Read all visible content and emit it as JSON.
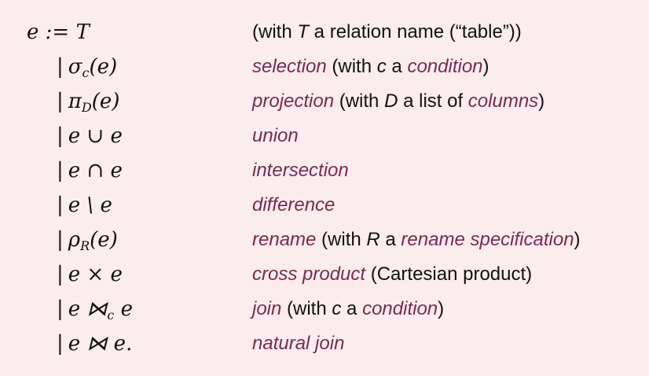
{
  "grammar": {
    "rows": [
      {
        "lhs": {
          "bar": "",
          "a": "e := T",
          "sub": "",
          "b": ""
        },
        "rhs": [
          {
            "text": "(with ",
            "style": "plain"
          },
          {
            "text": "T",
            "style": "var"
          },
          {
            "text": " a relation name (“table”))",
            "style": "plain"
          }
        ]
      },
      {
        "lhs": {
          "bar": "|",
          "a": "σ",
          "sub": "c",
          "b": "(e)"
        },
        "rhs": [
          {
            "text": "selection",
            "style": "hl"
          },
          {
            "text": " (with ",
            "style": "plain"
          },
          {
            "text": "c",
            "style": "var"
          },
          {
            "text": " a ",
            "style": "plain"
          },
          {
            "text": "condition",
            "style": "hl"
          },
          {
            "text": ")",
            "style": "plain"
          }
        ]
      },
      {
        "lhs": {
          "bar": "|",
          "a": "π",
          "sub": "D",
          "b": "(e)"
        },
        "rhs": [
          {
            "text": "projection",
            "style": "hl"
          },
          {
            "text": " (with ",
            "style": "plain"
          },
          {
            "text": "D",
            "style": "var"
          },
          {
            "text": " a list of ",
            "style": "plain"
          },
          {
            "text": "columns",
            "style": "hl"
          },
          {
            "text": ")",
            "style": "plain"
          }
        ]
      },
      {
        "lhs": {
          "bar": "|",
          "a": "e ∪ e",
          "sub": "",
          "b": ""
        },
        "rhs": [
          {
            "text": "union",
            "style": "hl"
          }
        ]
      },
      {
        "lhs": {
          "bar": "|",
          "a": "e ∩ e",
          "sub": "",
          "b": ""
        },
        "rhs": [
          {
            "text": "intersection",
            "style": "hl"
          }
        ]
      },
      {
        "lhs": {
          "bar": "|",
          "a": "e \\ e",
          "sub": "",
          "b": ""
        },
        "rhs": [
          {
            "text": "difference",
            "style": "hl"
          }
        ]
      },
      {
        "lhs": {
          "bar": "|",
          "a": "ρ",
          "sub": "R",
          "b": "(e)"
        },
        "rhs": [
          {
            "text": "rename",
            "style": "hl"
          },
          {
            "text": " (with ",
            "style": "plain"
          },
          {
            "text": "R",
            "style": "var"
          },
          {
            "text": " a ",
            "style": "plain"
          },
          {
            "text": "rename specification",
            "style": "hl"
          },
          {
            "text": ")",
            "style": "plain"
          }
        ]
      },
      {
        "lhs": {
          "bar": "|",
          "a": "e × e",
          "sub": "",
          "b": ""
        },
        "rhs": [
          {
            "text": "cross product",
            "style": "hl"
          },
          {
            "text": " (Cartesian product)",
            "style": "plain"
          }
        ]
      },
      {
        "lhs": {
          "bar": "|",
          "a": "e ⋈",
          "sub": "c",
          "b": " e"
        },
        "rhs": [
          {
            "text": "join",
            "style": "hl"
          },
          {
            "text": " (with ",
            "style": "plain"
          },
          {
            "text": "c",
            "style": "var"
          },
          {
            "text": " a ",
            "style": "plain"
          },
          {
            "text": "condition",
            "style": "hl"
          },
          {
            "text": ")",
            "style": "plain"
          }
        ]
      },
      {
        "lhs": {
          "bar": "|",
          "a": "e ⋈ e.",
          "sub": "",
          "b": ""
        },
        "rhs": [
          {
            "text": "natural join",
            "style": "hl"
          }
        ]
      }
    ]
  }
}
